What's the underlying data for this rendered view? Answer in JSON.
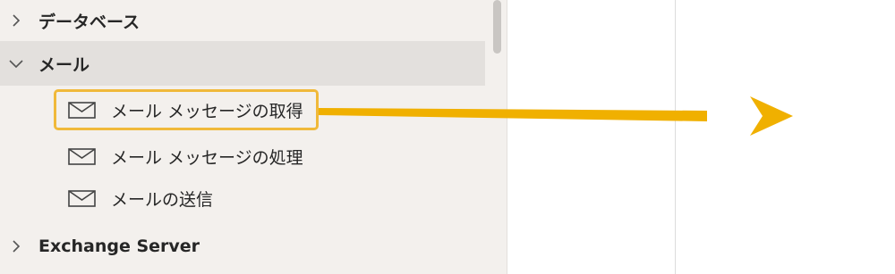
{
  "actions_panel": {
    "groups": [
      {
        "label": "データベース",
        "expanded": false,
        "icon": "chevron-right-icon"
      },
      {
        "label": "メール",
        "expanded": true,
        "icon": "chevron-down-icon"
      },
      {
        "label": "Exchange Server",
        "expanded": false,
        "icon": "chevron-right-icon"
      }
    ],
    "mail_actions": [
      {
        "label": "メール メッセージの取得",
        "icon": "mail-icon",
        "highlighted": true
      },
      {
        "label": "メール メッセージの処理",
        "icon": "mail-icon",
        "highlighted": false
      },
      {
        "label": "メールの送信",
        "icon": "mail-icon",
        "highlighted": false
      }
    ]
  },
  "colors": {
    "panel_background": "#f3f0ed",
    "selected_row": "#e3e0dd",
    "highlight": "#f0b93a",
    "arrow": "#f0b000",
    "text": "#262626"
  }
}
